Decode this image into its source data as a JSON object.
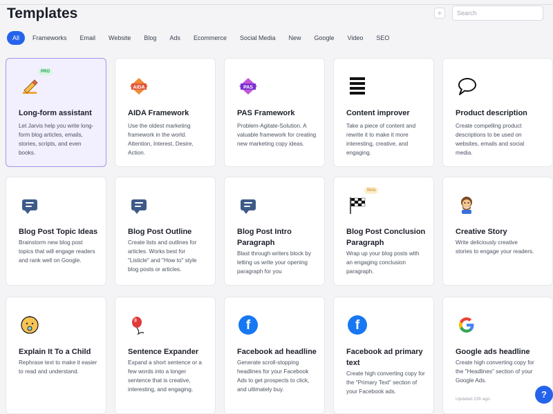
{
  "page": {
    "title": "Templates"
  },
  "search": {
    "placeholder": "Search"
  },
  "filters": [
    "All",
    "Frameworks",
    "Email",
    "Website",
    "Blog",
    "Ads",
    "Ecommerce",
    "Social Media",
    "New",
    "Google",
    "Video",
    "SEO"
  ],
  "active_filter": "All",
  "cards": [
    {
      "title": "Long-form assistant",
      "desc": "Let Jarvis help you write long-form blog articles, emails, stories, scripts, and even books.",
      "icon": "pencil-icon",
      "badge": "PRO",
      "selected": true
    },
    {
      "title": "AIDA Framework",
      "desc": "Use the oldest marketing framework in the world. Attention, Interest, Desire, Action.",
      "icon": "aida-icon",
      "icon_text": "AIDA"
    },
    {
      "title": "PAS Framework",
      "desc": "Problem-Agitate-Solution. A valuable framework for creating new marketing copy ideas.",
      "icon": "pas-icon",
      "icon_text": "PAS"
    },
    {
      "title": "Content improver",
      "desc": "Take a piece of content and rewrite it to make it more interesting, creative, and engaging.",
      "icon": "lines-icon"
    },
    {
      "title": "Product description",
      "desc": "Create compelling product descriptions to be used on websites, emails and social media.",
      "icon": "speech-bubble-icon"
    },
    {
      "title": "Blog Post Topic Ideas",
      "desc": "Brainstorm new blog post topics that will engage readers and rank well on Google.",
      "icon": "chat-icon"
    },
    {
      "title": "Blog Post Outline",
      "desc": "Create lists and outlines for articles. Works best for \"Listicle\" and \"How to\" style blog posts or articles.",
      "icon": "chat-icon"
    },
    {
      "title": "Blog Post Intro Paragraph",
      "desc": "Blast through writers block by letting us write your opening paragraph for you",
      "icon": "chat-icon"
    },
    {
      "title": "Blog Post Conclusion Paragraph",
      "desc": "Wrap up your blog posts with an engaging conclusion paragraph.",
      "icon": "checkered-flag-icon",
      "badge": "Beta"
    },
    {
      "title": "Creative Story",
      "desc": "Write deliciously creative stories to engage your readers.",
      "icon": "storyteller-icon"
    },
    {
      "title": "Explain It To a Child",
      "desc": "Rephrase text to make it easier to read and understand.",
      "icon": "baby-icon"
    },
    {
      "title": "Sentence Expander",
      "desc": "Expand a short sentence or a few words into a longer sentence that is creative, interesting, and engaging.",
      "icon": "balloon-icon"
    },
    {
      "title": "Facebook ad headline",
      "desc": "Generate scroll-stopping headlines for your Facebook Ads to get prospects to click, and ultimately buy.",
      "icon": "facebook-icon"
    },
    {
      "title": "Facebook ad primary text",
      "desc": "Create high converting copy for the \"Primary Text\" section of your Facebook ads.",
      "icon": "facebook-icon"
    },
    {
      "title": "Google ads headline",
      "desc": "Create high converting copy for the \"Headlines\" section of your Google Ads.",
      "icon": "google-icon",
      "updated": "Updated 23h ago"
    }
  ],
  "help": {
    "label": "?"
  },
  "colors": {
    "accent": "#2563eb",
    "selected_bg": "#f2efff",
    "selected_border": "#a594e8"
  }
}
